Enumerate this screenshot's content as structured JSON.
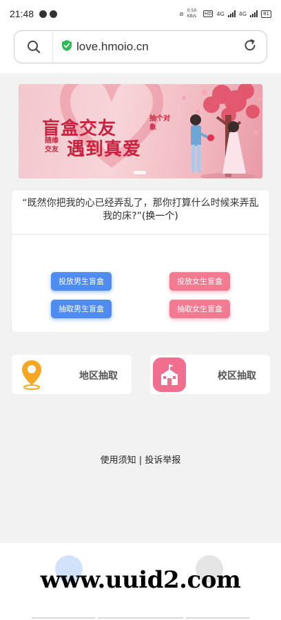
{
  "status_bar": {
    "time": "21:48",
    "net_speed": "0.50 KB/s",
    "net1": "4G",
    "net2": "4G",
    "battery": "81"
  },
  "address_bar": {
    "url": "love.hmoio.cn",
    "icons": [
      "search-icon",
      "shield-check-icon",
      "reload-icon"
    ]
  },
  "banner": {
    "title1": "盲盒交友",
    "sub1": "抽个对象",
    "sub2": "随缘交友",
    "title2": "遇到真爱"
  },
  "quote_card": {
    "quote": "“既然你把我的心已经弄乱了，那你打算什么时候来弄乱我的床?”",
    "action": "(换一个)",
    "buttons": {
      "put_male": "投放男生盲盒",
      "take_male": "抽取男生盲盒",
      "put_female": "投放女生盲盒",
      "take_female": "抽取女生盲盒"
    }
  },
  "features": {
    "region": "地区抽取",
    "campus": "校区抽取"
  },
  "footer": {
    "terms": "使用须知",
    "separator": "|",
    "report": "投诉举报"
  },
  "watermark": "www.uuid2.com",
  "colors": {
    "blue_button": "#4f8bf0",
    "pink_button": "#f27b91",
    "banner_text": "#c9223f",
    "region_icon": "#f5a623",
    "campus_icon": "#f06f8e"
  }
}
